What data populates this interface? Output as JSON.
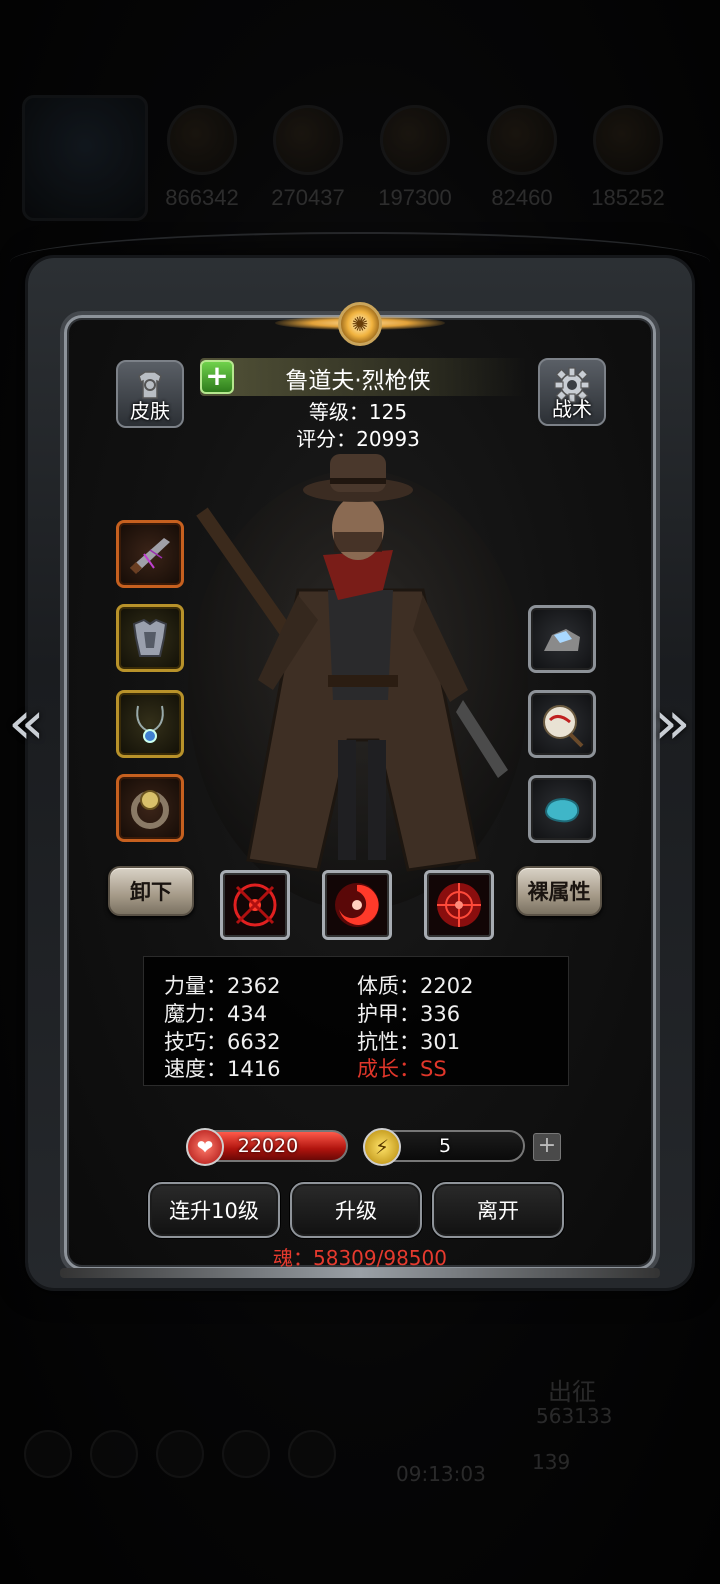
{
  "background": {
    "resources": [
      {
        "icon": "coin-icon",
        "value": "866342"
      },
      {
        "icon": "grain-icon",
        "value": "270437"
      },
      {
        "icon": "wood-icon",
        "value": "197300"
      },
      {
        "icon": "gem-icon",
        "value": "82460"
      },
      {
        "icon": "iron-icon",
        "value": "185252"
      }
    ],
    "timer": "09:13:03",
    "expedition_label": "出征",
    "expedition_value": "563133",
    "gem_value": "139"
  },
  "header": {
    "skin_label": "皮肤",
    "tactics_label": "战术",
    "hero_name": "鲁道夫·烈枪侠",
    "level_text": "等级：125",
    "score_text": "评分：20993"
  },
  "equipment_left": [
    {
      "name": "rifle-icon",
      "rarity": "orange"
    },
    {
      "name": "armor-icon",
      "rarity": "gold"
    },
    {
      "name": "necklace-icon",
      "rarity": "gold"
    },
    {
      "name": "ring-icon",
      "rarity": "orange"
    }
  ],
  "equipment_right": [
    {
      "name": "crystal-stone-icon",
      "rarity": "grey"
    },
    {
      "name": "seal-scroll-icon",
      "rarity": "grey"
    },
    {
      "name": "blue-gem-icon",
      "rarity": "grey"
    }
  ],
  "actions": {
    "unequip_label": "卸下",
    "base_attr_label": "裸属性"
  },
  "skills": [
    "crosshair-rune-icon",
    "vortex-icon",
    "target-icon"
  ],
  "stats": {
    "strength": "力量：2362",
    "constitution": "体质：2202",
    "magic": "魔力：434",
    "armor": "护甲：336",
    "skill": "技巧：6632",
    "resistance": "抗性：301",
    "speed": "速度：1416",
    "growth": "成长：SS"
  },
  "bars": {
    "hp": "22020",
    "energy": "5",
    "add": "+"
  },
  "buttons": {
    "level10": "连升10级",
    "levelup": "升级",
    "leave": "离开"
  },
  "soul_text": "魂：58309/98500",
  "colors": {
    "accent_red": "#e0362a",
    "frame_silver": "#8d939a",
    "rarity_orange": "#c6601f",
    "rarity_gold": "#b8922a"
  }
}
